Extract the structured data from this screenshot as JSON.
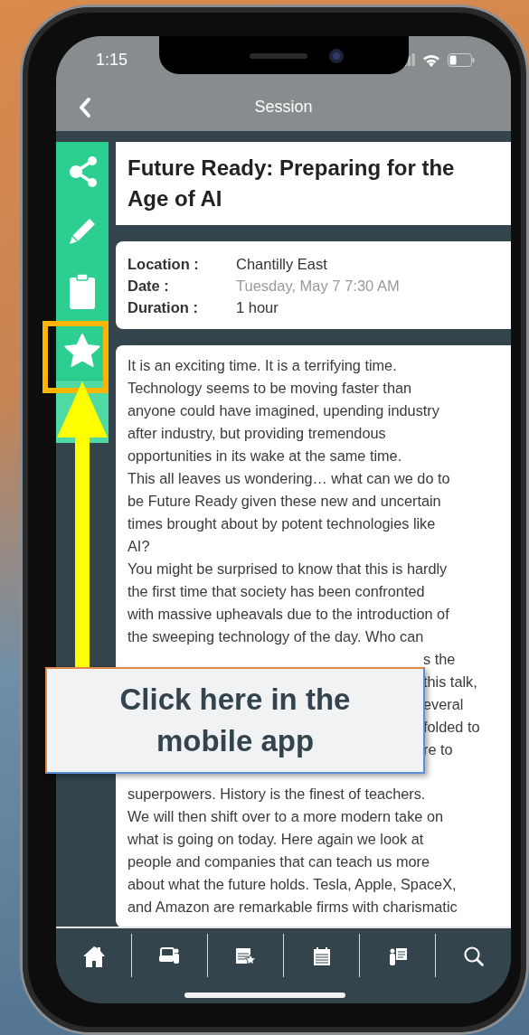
{
  "status_bar": {
    "time": "1:15"
  },
  "header": {
    "title": "Session"
  },
  "side_actions": [
    {
      "kind": "share",
      "highlighted": false
    },
    {
      "kind": "edit",
      "highlighted": false
    },
    {
      "kind": "clipboard",
      "highlighted": false
    },
    {
      "kind": "favorite",
      "highlighted": true
    }
  ],
  "session": {
    "title": "Future Ready: Preparing for the Age of AI",
    "details": [
      {
        "label": "Location :",
        "value": "Chantilly East",
        "muted": false
      },
      {
        "label": "Date :",
        "value": "Tuesday, May 7 7:30 AM",
        "muted": true
      },
      {
        "label": "Duration :",
        "value": "1 hour",
        "muted": false
      }
    ],
    "description": [
      {
        "kind": "line",
        "text": "It is an exciting time. It is a terrifying time."
      },
      {
        "kind": "line",
        "text": "Technology seems to be moving faster than"
      },
      {
        "kind": "line",
        "text": "anyone could have imagined, upending industry"
      },
      {
        "kind": "line",
        "text": "after industry, but providing tremendous"
      },
      {
        "kind": "line",
        "text": "opportunities in its wake at the same time."
      },
      {
        "kind": "line",
        "text": "This all leaves us wondering… what can we do to"
      },
      {
        "kind": "line",
        "text": "be Future Ready given these new and uncertain"
      },
      {
        "kind": "line",
        "text": "times brought about by potent technologies like"
      },
      {
        "kind": "line",
        "text": "AI?"
      },
      {
        "kind": "line",
        "text": "You might be surprised to know that this is hardly"
      },
      {
        "kind": "line",
        "text": "the first time that society has been confronted"
      },
      {
        "kind": "line",
        "text": "with massive upheavals due to the introduction of"
      },
      {
        "kind": "line",
        "text": "the sweeping technology of the day. Who can"
      },
      {
        "kind": "fragment",
        "text": "s the"
      },
      {
        "kind": "fragment",
        "text": "this talk,"
      },
      {
        "kind": "fragment",
        "text": "everal"
      },
      {
        "kind": "fragment",
        "text": "folded to"
      },
      {
        "kind": "fragment",
        "text": "re to"
      },
      {
        "kind": "resume",
        "text": "superpowers. History is the finest of teachers."
      },
      {
        "kind": "line",
        "text": "We will then shift over to a more modern take on"
      },
      {
        "kind": "line",
        "text": "what is going on today. Here again we look at"
      },
      {
        "kind": "line",
        "text": "people and companies that can teach us more"
      },
      {
        "kind": "line",
        "text": "about what the future holds. Tesla, Apple, SpaceX,"
      },
      {
        "kind": "line",
        "text": "and Amazon are remarkable firms with charismatic"
      }
    ]
  },
  "tab_bar": [
    {
      "kind": "home"
    },
    {
      "kind": "presenter"
    },
    {
      "kind": "favorites"
    },
    {
      "kind": "agenda"
    },
    {
      "kind": "speakers"
    },
    {
      "kind": "search"
    }
  ],
  "callout": {
    "text": "Click here in the mobile app"
  }
}
